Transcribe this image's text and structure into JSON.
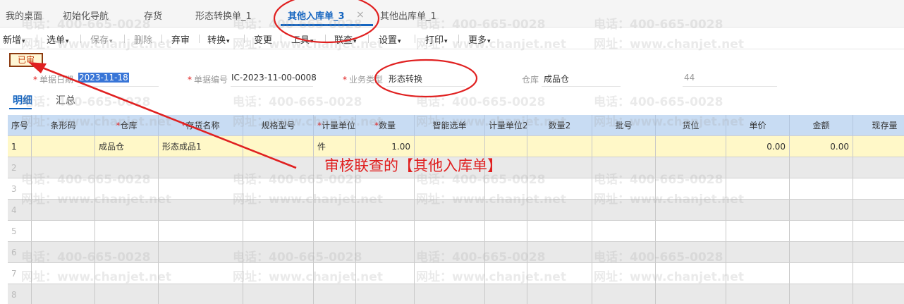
{
  "tabs": [
    {
      "label": "我的桌面"
    },
    {
      "label": "初始化导航"
    },
    {
      "label": "存货"
    },
    {
      "label": "形态转换单_1"
    },
    {
      "label": "其他入库单_3",
      "active": true,
      "close": "×"
    },
    {
      "label": "其他出库单_1"
    }
  ],
  "toolbar": {
    "items": [
      "新增",
      "选单",
      "保存",
      "删除",
      "弃审",
      "转换",
      "变更",
      "工具",
      "联查",
      "设置",
      "打印",
      "更多"
    ]
  },
  "status": {
    "label": "已审"
  },
  "form": {
    "date_label": "单据日期",
    "date_value": "2023-11-18",
    "code_label": "单据编号",
    "code_value": "IC-2023-11-00-0008",
    "biz_type_label": "业务类型",
    "biz_type_value": "形态转换",
    "warehouse_label": "仓库",
    "warehouse_value": "成品仓",
    "extra_value": "44"
  },
  "subtabs": [
    "明细",
    "汇总"
  ],
  "table": {
    "columns": [
      {
        "label": "序号",
        "required": false
      },
      {
        "label": "条形码",
        "required": false
      },
      {
        "label": "仓库",
        "required": true
      },
      {
        "label": "存货名称",
        "required": true
      },
      {
        "label": "规格型号",
        "required": false
      },
      {
        "label": "计量单位",
        "required": true
      },
      {
        "label": "数量",
        "required": true
      },
      {
        "label": "智能选单",
        "required": false
      },
      {
        "label": "计量单位2",
        "required": false
      },
      {
        "label": "数量2",
        "required": false
      },
      {
        "label": "批号",
        "required": false
      },
      {
        "label": "货位",
        "required": false
      },
      {
        "label": "单价",
        "required": false
      },
      {
        "label": "金额",
        "required": false
      },
      {
        "label": "现存量",
        "required": false
      }
    ],
    "rows": [
      {
        "no": "1",
        "barcode": "",
        "warehouse": "成品仓",
        "name": "形态成品1",
        "spec": "",
        "unit": "件",
        "qty": "1.00",
        "smart": "",
        "unit2": "",
        "qty2": "",
        "batch": "",
        "location": "",
        "price": "0.00",
        "amount": "0.00",
        "stock": ""
      },
      {
        "no": "2"
      },
      {
        "no": "3"
      },
      {
        "no": "4"
      },
      {
        "no": "5"
      },
      {
        "no": "6"
      },
      {
        "no": "7"
      },
      {
        "no": "8"
      }
    ]
  },
  "watermark": {
    "phone": "电话：400-665-0028",
    "site": "网址：www.chanjet.net"
  },
  "annotation": {
    "text": "审核联查的【其他入库单】",
    "color": "#e02020"
  },
  "colors": {
    "accent": "#1565c0",
    "header_bg": "#c8dcf3",
    "active_row": "#fff8c8",
    "annotation": "#e02020"
  }
}
